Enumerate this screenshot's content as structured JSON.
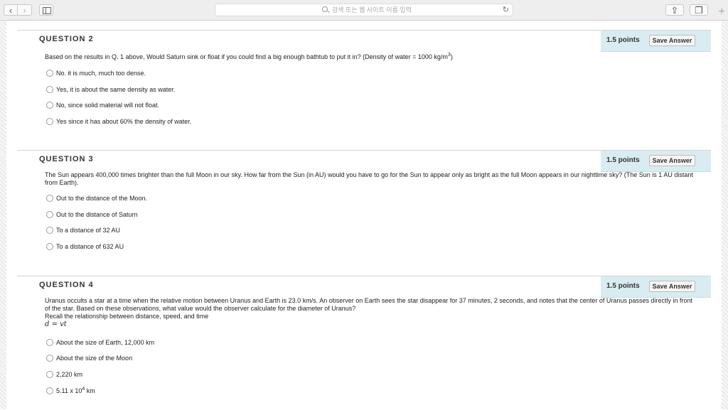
{
  "browser": {
    "address_placeholder": "검색 또는 웹 사이트 이름 입력",
    "reload_glyph": "↻",
    "back_glyph": "‹",
    "forward_glyph": "›",
    "share_glyph": "⇪",
    "tabs_glyph": "❐",
    "new_tab_glyph": "+"
  },
  "questions": [
    {
      "title": "QUESTION 2",
      "points": "1.5 points",
      "save_label": "Save Answer",
      "text_main": "Based on the results in Q. 1 above, Would Saturn sink or float if you could find a big enough bathtub to put it in? (Density of water = 1000 kg/m",
      "text_sup": "3",
      "text_end": ")",
      "options": [
        "No. it is much, much too dense.",
        "Yes, it is about the same density as water.",
        "No, since solid material will not float.",
        "Yes since it has about 60% the density of water."
      ]
    },
    {
      "title": "QUESTION 3",
      "points": "1.5 points",
      "save_label": "Save Answer",
      "text_main": "The Sun appears 400,000 times brighter than the full Moon in our sky. How far from the Sun (in AU) would you have to go for the Sun to appear only as bright as the full Moon appears in our nighttime sky? (The Sun is 1 AU distant from Earth).",
      "options": [
        "Out to the distance of the Moon.",
        "Out to the distance of Saturn",
        "To a distance of 32 AU",
        "To a distance of 632 AU"
      ]
    },
    {
      "title": "QUESTION 4",
      "points": "1.5 points",
      "save_label": "Save Answer",
      "text_main": "Uranus occults a star at a time when the relative motion between Uranus and Earth is 23.0 km/s. An observer on Earth sees the star disappear for 37 minutes, 2 seconds, and notes that the center of Uranus passes directly in front of the star. Based on these observations, what value would the observer calculate for the diameter of Uranus?",
      "text_recall": "Recall the relationship between distance, speed, and time",
      "formula": "d = vt",
      "options": [
        "About the size of Earth, 12,000 km",
        "About the size of the Moon",
        "2,220 km"
      ],
      "option4_base": "5.11 x 10",
      "option4_sup": "4",
      "option4_end": " km"
    }
  ]
}
